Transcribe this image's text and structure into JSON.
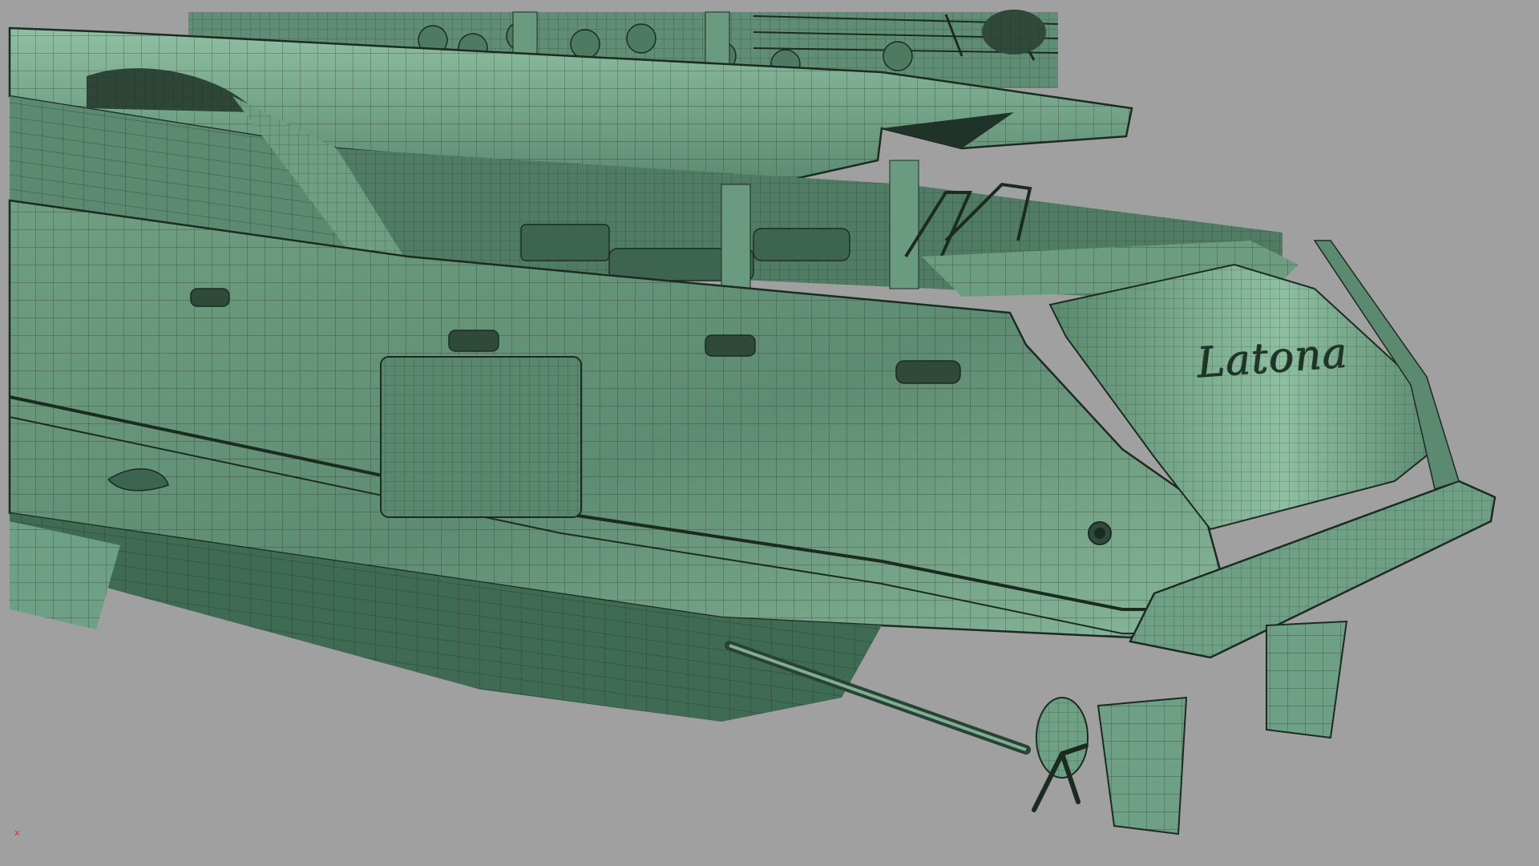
{
  "viewport": {
    "background": "#a0a0a0",
    "axis_label": "x",
    "axis_color": "#e0302a"
  },
  "model": {
    "subject": "yacht-stern-wireframe",
    "hull_name": "Latona",
    "fill_color": "#5f8f74",
    "highlight_color": "#9cc8ac",
    "wire_color": "#1c2b22"
  }
}
